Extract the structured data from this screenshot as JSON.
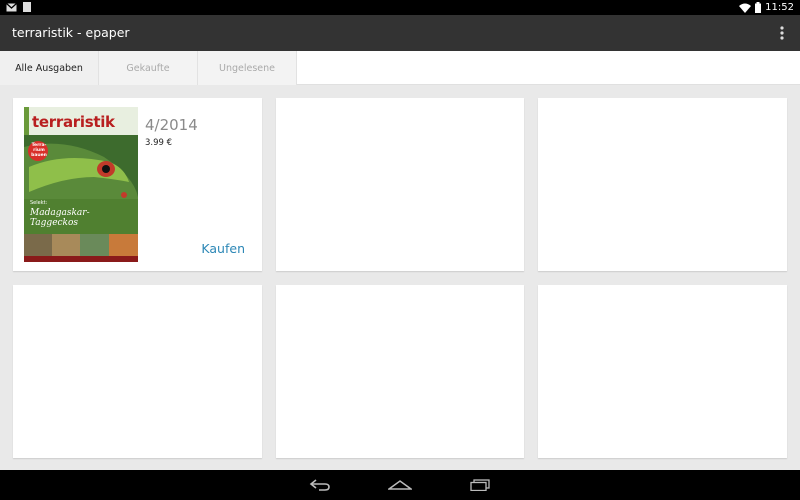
{
  "status_bar": {
    "time": "11:52",
    "left_icons": [
      "gmail-icon",
      "document-icon"
    ],
    "right_icons": [
      "wifi-icon",
      "battery-icon"
    ]
  },
  "action_bar": {
    "title": "terraristik - epaper",
    "overflow_icon": "overflow-menu-icon"
  },
  "tabs": [
    {
      "label": "Alle Ausgaben",
      "active": true
    },
    {
      "label": "Gekaufte",
      "active": false
    },
    {
      "label": "Ungelesene",
      "active": false
    }
  ],
  "issues": [
    {
      "issue": "4/2014",
      "price": "3.99 €",
      "action": "Kaufen",
      "cover": {
        "masthead": "terraristik",
        "badge": [
          "Terra-",
          "rium",
          "bauen"
        ],
        "subtitle_small": "Selekt:",
        "subtitle_script": "Madagaskar-Taggeckos"
      }
    }
  ],
  "navigation": {
    "back_icon": "back-icon",
    "home_icon": "home-icon",
    "recents_icon": "recents-icon"
  },
  "colors": {
    "action_bar": "#333333",
    "accent_link": "#2c87b6",
    "background": "#e9e9e9"
  }
}
